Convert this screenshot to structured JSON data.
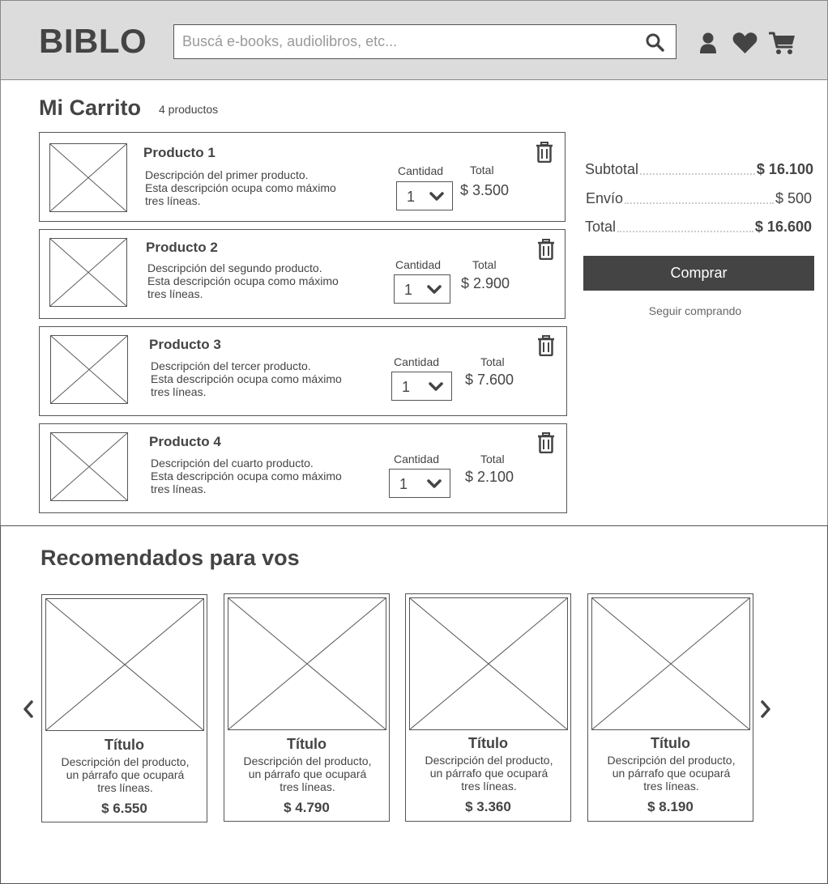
{
  "header": {
    "logo": "BIBLO",
    "search_placeholder": "Buscá e-books, audiolibros, etc...",
    "icons": [
      "search-icon",
      "user-icon",
      "heart-icon",
      "cart-icon"
    ]
  },
  "cart": {
    "title": "Mi Carrito",
    "count": "4 productos",
    "quantity_label": "Cantidad",
    "total_label": "Total",
    "items": [
      {
        "name": "Producto 1",
        "desc": [
          "Descripción del primer producto.",
          "Esta descripción ocupa como máximo",
          "tres líneas."
        ],
        "qty": "1",
        "total": "$ 3.500"
      },
      {
        "name": "Producto 2",
        "desc": [
          "Descripción del segundo producto.",
          "Esta descripción ocupa como máximo",
          "tres líneas."
        ],
        "qty": "1",
        "total": "$ 2.900"
      },
      {
        "name": "Producto 3",
        "desc": [
          "Descripción del tercer producto.",
          "Esta descripción ocupa como máximo",
          "tres líneas."
        ],
        "qty": "1",
        "total": "$ 7.600"
      },
      {
        "name": "Producto 4",
        "desc": [
          "Descripción del cuarto producto.",
          "Esta descripción ocupa como máximo",
          "tres líneas."
        ],
        "qty": "1",
        "total": "$ 2.100"
      }
    ]
  },
  "summary": {
    "subtotal_label": "Subtotal",
    "subtotal_value": "$ 16.100",
    "shipping_label": "Envío",
    "shipping_value": "$ 500",
    "total_label": "Total",
    "total_value": "$ 16.600",
    "buy_label": "Comprar",
    "keep_label": "Seguir comprando"
  },
  "recommended": {
    "title": "Recomendados para vos",
    "products": [
      {
        "title": "Título",
        "desc": [
          "Descripción del producto,",
          "un párrafo que ocupará",
          "tres líneas."
        ],
        "price": "$ 6.550"
      },
      {
        "title": "Título",
        "desc": [
          "Descripción del producto,",
          "un párrafo que ocupará",
          "tres líneas."
        ],
        "price": "$ 4.790"
      },
      {
        "title": "Título",
        "desc": [
          "Descripción del producto,",
          "un párrafo que ocupará",
          "tres líneas."
        ],
        "price": "$ 3.360"
      },
      {
        "title": "Título",
        "desc": [
          "Descripción del producto,",
          "un párrafo que ocupará",
          "tres líneas."
        ],
        "price": "$ 8.190"
      }
    ]
  }
}
